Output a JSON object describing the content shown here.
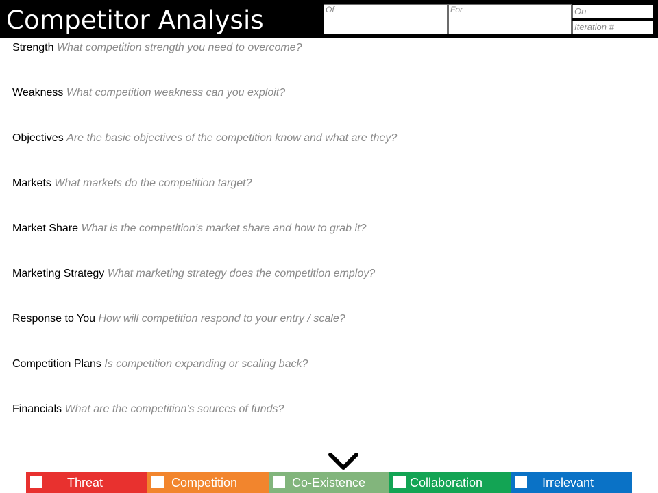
{
  "header": {
    "title": "Competitor Analysis",
    "fields": {
      "of": "Of",
      "for": "For",
      "on": "On",
      "iteration": "Iteration #"
    }
  },
  "prompts": [
    {
      "label": "Strength",
      "hint": "What competition strength you need to overcome?"
    },
    {
      "label": "Weakness",
      "hint": "What competition weakness can you exploit?"
    },
    {
      "label": "Objectives",
      "hint": "Are the basic objectives of the competition know and what are they?"
    },
    {
      "label": "Markets",
      "hint": "What markets do the competition target?"
    },
    {
      "label": "Market Share",
      "hint": "What is the competition’s market share and how to grab it?"
    },
    {
      "label": "Marketing Strategy",
      "hint": "What marketing strategy does the competition employ?"
    },
    {
      "label": "Response to You",
      "hint": "How will competition respond to your entry / scale?"
    },
    {
      "label": "Competition Plans",
      "hint": "Is competition expanding or scaling back?"
    },
    {
      "label": "Financials",
      "hint": "What are the competition’s sources of funds?"
    }
  ],
  "indicator": {
    "icon": "chevron-down-icon",
    "pointing_to": "Co-Existence"
  },
  "classification": [
    {
      "label": "Threat",
      "color": "#e8312f",
      "checked": false
    },
    {
      "label": "Competition",
      "color": "#f2852d",
      "checked": false
    },
    {
      "label": "Co-Existence",
      "color": "#82b57c",
      "checked": false
    },
    {
      "label": "Collaboration",
      "color": "#13a454",
      "checked": false
    },
    {
      "label": "Irrelevant",
      "color": "#0a72c6",
      "checked": false
    }
  ]
}
